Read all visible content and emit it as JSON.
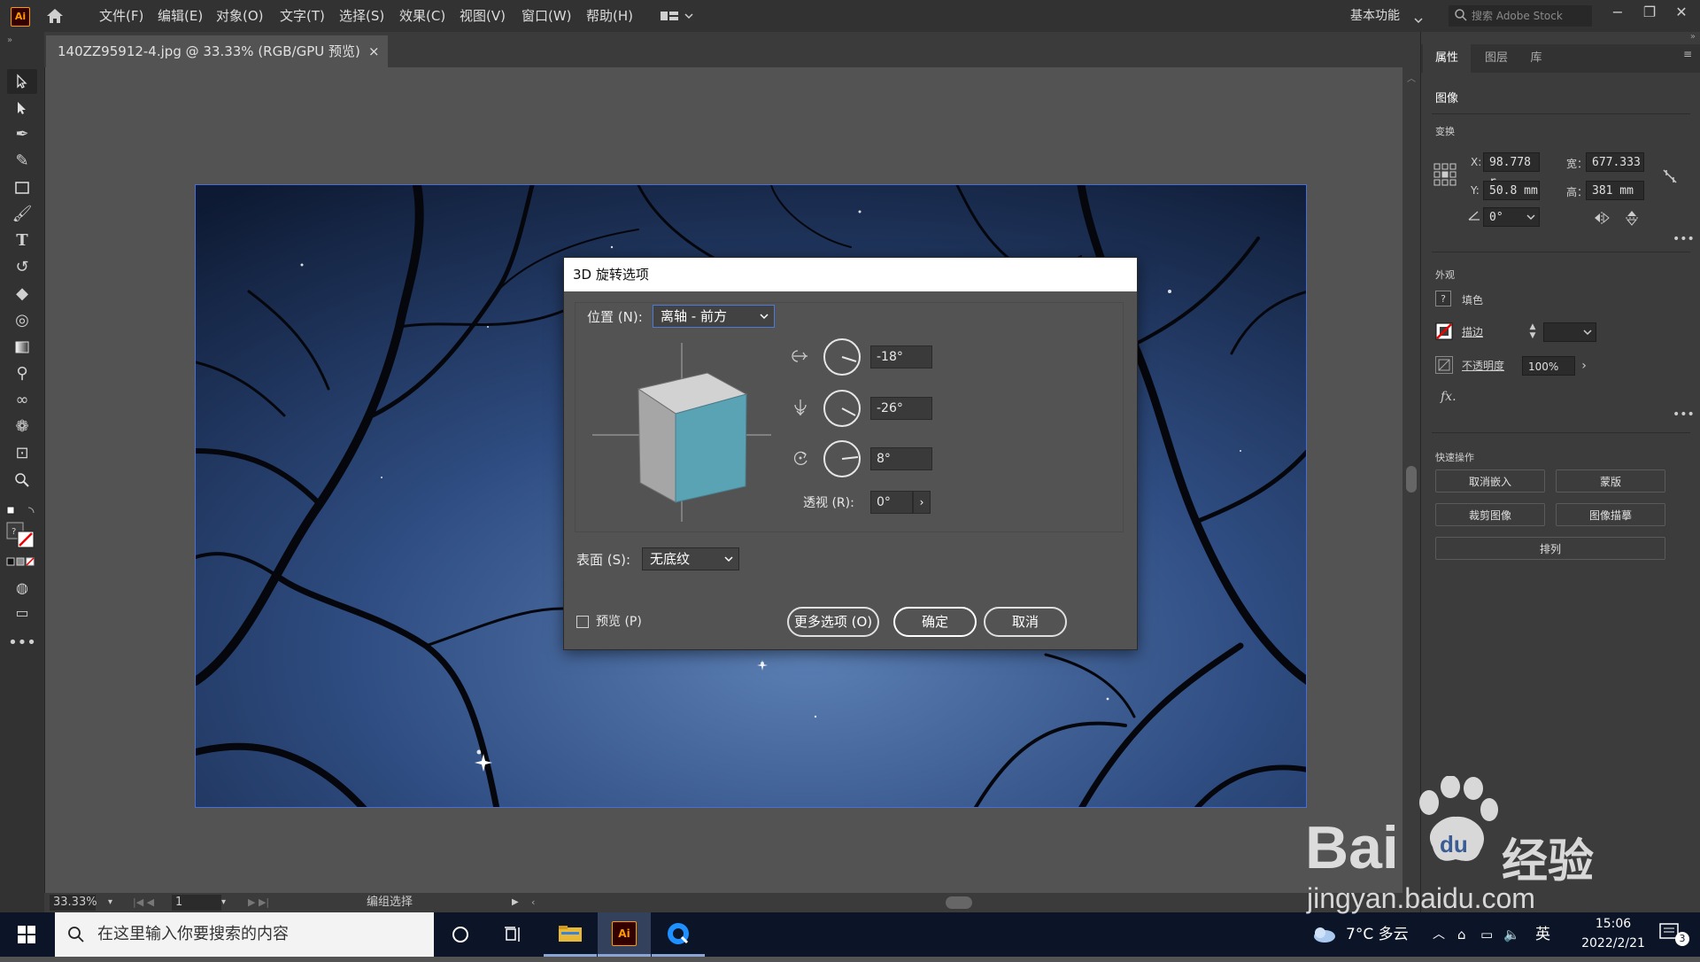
{
  "app": {
    "logo_text": "Ai"
  },
  "menu": [
    "文件(F)",
    "编辑(E)",
    "对象(O)",
    "文字(T)",
    "选择(S)",
    "效果(C)",
    "视图(V)",
    "窗口(W)",
    "帮助(H)"
  ],
  "workspace": {
    "label": "基本功能"
  },
  "stock_search": {
    "placeholder": "搜索 Adobe Stock"
  },
  "document_tab": {
    "title": "140ZZ95912-4.jpg @ 33.33% (RGB/GPU 预览)",
    "close": "×"
  },
  "right_panel": {
    "tabs": [
      "属性",
      "图层",
      "库"
    ],
    "section_image": "图像",
    "transform": {
      "title": "变换",
      "x_label": "X:",
      "x": "98.778 r",
      "y_label": "Y:",
      "y": "50.8 mm",
      "w_label": "宽：",
      "w": "677.333",
      "h_label": "高：",
      "h": "381 mm",
      "angle": "0°"
    },
    "appearance": {
      "title": "外观",
      "fill_label": "填色",
      "stroke_label": "描边",
      "opacity_label": "不透明度",
      "opacity": "100%",
      "fx": "fx."
    },
    "quick_actions": {
      "title": "快速操作",
      "buttons": [
        "取消嵌入",
        "蒙版",
        "裁剪图像",
        "图像描摹",
        "排列"
      ]
    }
  },
  "dialog": {
    "title": "3D 旋转选项",
    "position_label": "位置 (N):",
    "position_value": "离轴 - 前方",
    "x_rotation": "-18°",
    "y_rotation": "-26°",
    "z_rotation": "8°",
    "perspective_label": "透视 (R):",
    "perspective_value": "0°",
    "surface_label": "表面 (S):",
    "surface_value": "无底纹",
    "preview_label": "预览 (P)",
    "more_options": "更多选项 (O)",
    "ok": "确定",
    "cancel": "取消"
  },
  "statusbar": {
    "zoom": "33.33%",
    "artboard": "1",
    "mode": "编组选择"
  },
  "taskbar": {
    "search_placeholder": "在这里输入你要搜索的内容",
    "weather": "7°C 多云",
    "ime": "英",
    "time": "15:06",
    "date": "2022/2/21",
    "notifications": "3"
  },
  "watermark": {
    "brand": "Bai",
    "brand2": "经验",
    "url": "jingyan.baidu.com"
  },
  "colors": {
    "cube_front": "#5aa3b5",
    "cube_side": "#a4a4a4",
    "cube_top": "#cfcfcf",
    "accent": "#4a6fd4"
  }
}
